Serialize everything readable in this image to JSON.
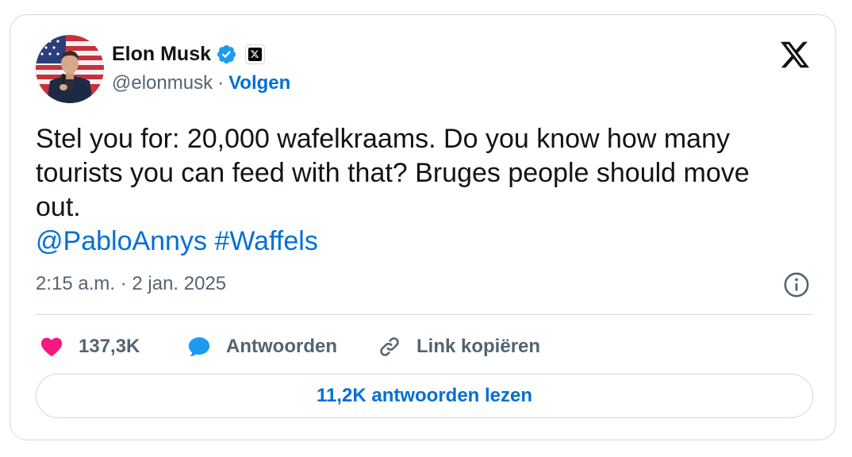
{
  "author": {
    "name": "Elon Musk",
    "handle": "@elonmusk",
    "separator": "·",
    "follow_label": "Volgen"
  },
  "tweet": {
    "lines": [
      "Stel you for: 20,000 wafelkraams. Do you know how many",
      "tourists you can feed with that? Bruges people should move",
      "out."
    ],
    "mention": "@PabloAnnys",
    "hashtag": "#Waffels",
    "timestamp": "2:15 a.m. · 2 jan. 2025"
  },
  "actions": {
    "likes": "137,3K",
    "reply_label": "Antwoorden",
    "copy_link_label": "Link kopiëren"
  },
  "read_replies_label": "11,2K antwoorden lezen",
  "icons": {
    "verified": "verified-badge-icon",
    "x_badge": "x-affiliation-icon",
    "x_logo": "x-logo-icon",
    "info": "info-icon",
    "like": "heart-icon",
    "reply": "speech-bubble-icon",
    "link": "link-icon"
  },
  "colors": {
    "accent": "#006fd6",
    "verified": "#1d9bf0",
    "like": "#f91880",
    "secondary_text": "#536471",
    "border": "#cfd9de"
  }
}
